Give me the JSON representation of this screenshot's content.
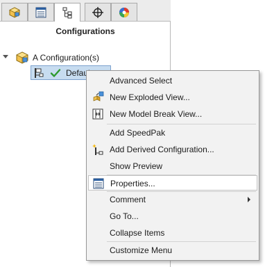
{
  "tabs": [
    {
      "icon": "part-feature-tree-icon",
      "active": false
    },
    {
      "icon": "property-manager-icon",
      "active": false
    },
    {
      "icon": "configuration-manager-icon",
      "active": true
    },
    {
      "icon": "dimxpert-crosshair-icon",
      "active": false
    },
    {
      "icon": "display-manager-icon",
      "active": false
    }
  ],
  "panel": {
    "title": "Configurations"
  },
  "tree": {
    "root_label": "A Configuration(s)",
    "child_label": "Default"
  },
  "context_menu": {
    "items": [
      {
        "label": "Advanced Select",
        "icon": "",
        "has_submenu": false
      },
      {
        "label": "New Exploded View...",
        "icon": "exploded-view-icon",
        "has_submenu": false
      },
      {
        "label": "New Model Break View...",
        "icon": "model-break-view-icon",
        "has_submenu": false
      },
      {
        "label": "Add SpeedPak",
        "icon": "",
        "has_submenu": false
      },
      {
        "label": "Add Derived Configuration...",
        "icon": "derived-configuration-icon",
        "has_submenu": false
      },
      {
        "label": "Show Preview",
        "icon": "",
        "has_submenu": false
      },
      {
        "label": "Properties...",
        "icon": "properties-icon",
        "has_submenu": false,
        "highlighted": true
      },
      {
        "label": "Comment",
        "icon": "",
        "has_submenu": true
      },
      {
        "label": "Go To...",
        "icon": "",
        "has_submenu": false
      },
      {
        "label": "Collapse Items",
        "icon": "",
        "has_submenu": false
      },
      {
        "label": "Customize Menu",
        "icon": "",
        "has_submenu": false
      }
    ]
  },
  "colors": {
    "selection_fill": "#c7dcf0",
    "selection_border": "#7da2ce",
    "menu_background": "#f2f2f2",
    "check_green": "#2e9a2e"
  }
}
